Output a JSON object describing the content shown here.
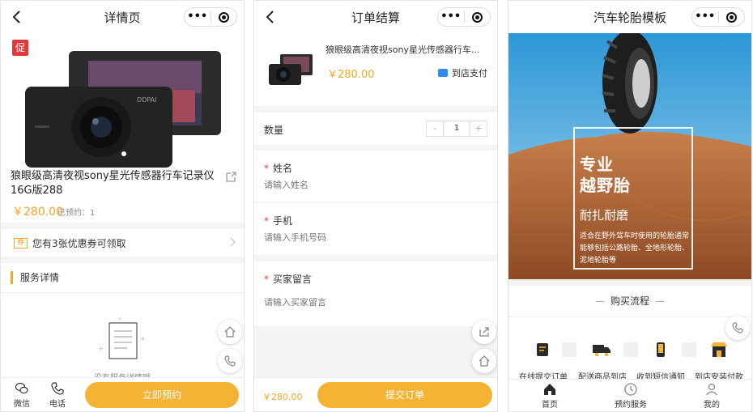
{
  "colors": {
    "accent": "#f5b335",
    "price": "#f5a623",
    "required": "#e4393c",
    "pay_icon": "#2d8cf0"
  },
  "screen1": {
    "title": "详情页",
    "promo_tag": "促",
    "product_title": "狼眼级高清夜视sony星光传感器行车记录仪16G版288",
    "price": "￥280.00",
    "booked": "已预约：1",
    "coupon_icon": "券",
    "coupon_text": "您有3张优惠券可领取",
    "service_header": "服务详情",
    "empty_text": "没有服务详情哦",
    "bottom": {
      "wechat": "微信",
      "phone": "电话",
      "cta": "立即预约"
    }
  },
  "screen2": {
    "title": "订单结算",
    "product_name": "狼眼级高清夜视sony星光传感器行车...",
    "price": "￥280.00",
    "pay_method": "到店支付",
    "qty_label": "数量",
    "qty_value": "1",
    "qty_minus": "-",
    "qty_plus": "+",
    "name_label": "姓名",
    "name_placeholder": "请输入姓名",
    "phone_label": "手机",
    "phone_placeholder": "请输入手机号码",
    "note_label": "买家留言",
    "note_placeholder": "请输入买家留言",
    "total": "￥280.00",
    "cta": "提交订单"
  },
  "screen3": {
    "title": "汽车轮胎模板",
    "banner_h1_line1": "专业",
    "banner_h1_line2": "越野胎",
    "banner_sub": "耐扎耐磨",
    "banner_desc": "适合在野外驾车时使用的轮胎通常能够包括公路轮胎、全地形轮胎、泥地轮胎等",
    "flow_title": "购买流程",
    "flow_steps": [
      "在线提交订单",
      "配送商品到店",
      "收到短信通知",
      "到店安装付款"
    ],
    "tabs": [
      "首页",
      "预约服务",
      "我的"
    ]
  }
}
